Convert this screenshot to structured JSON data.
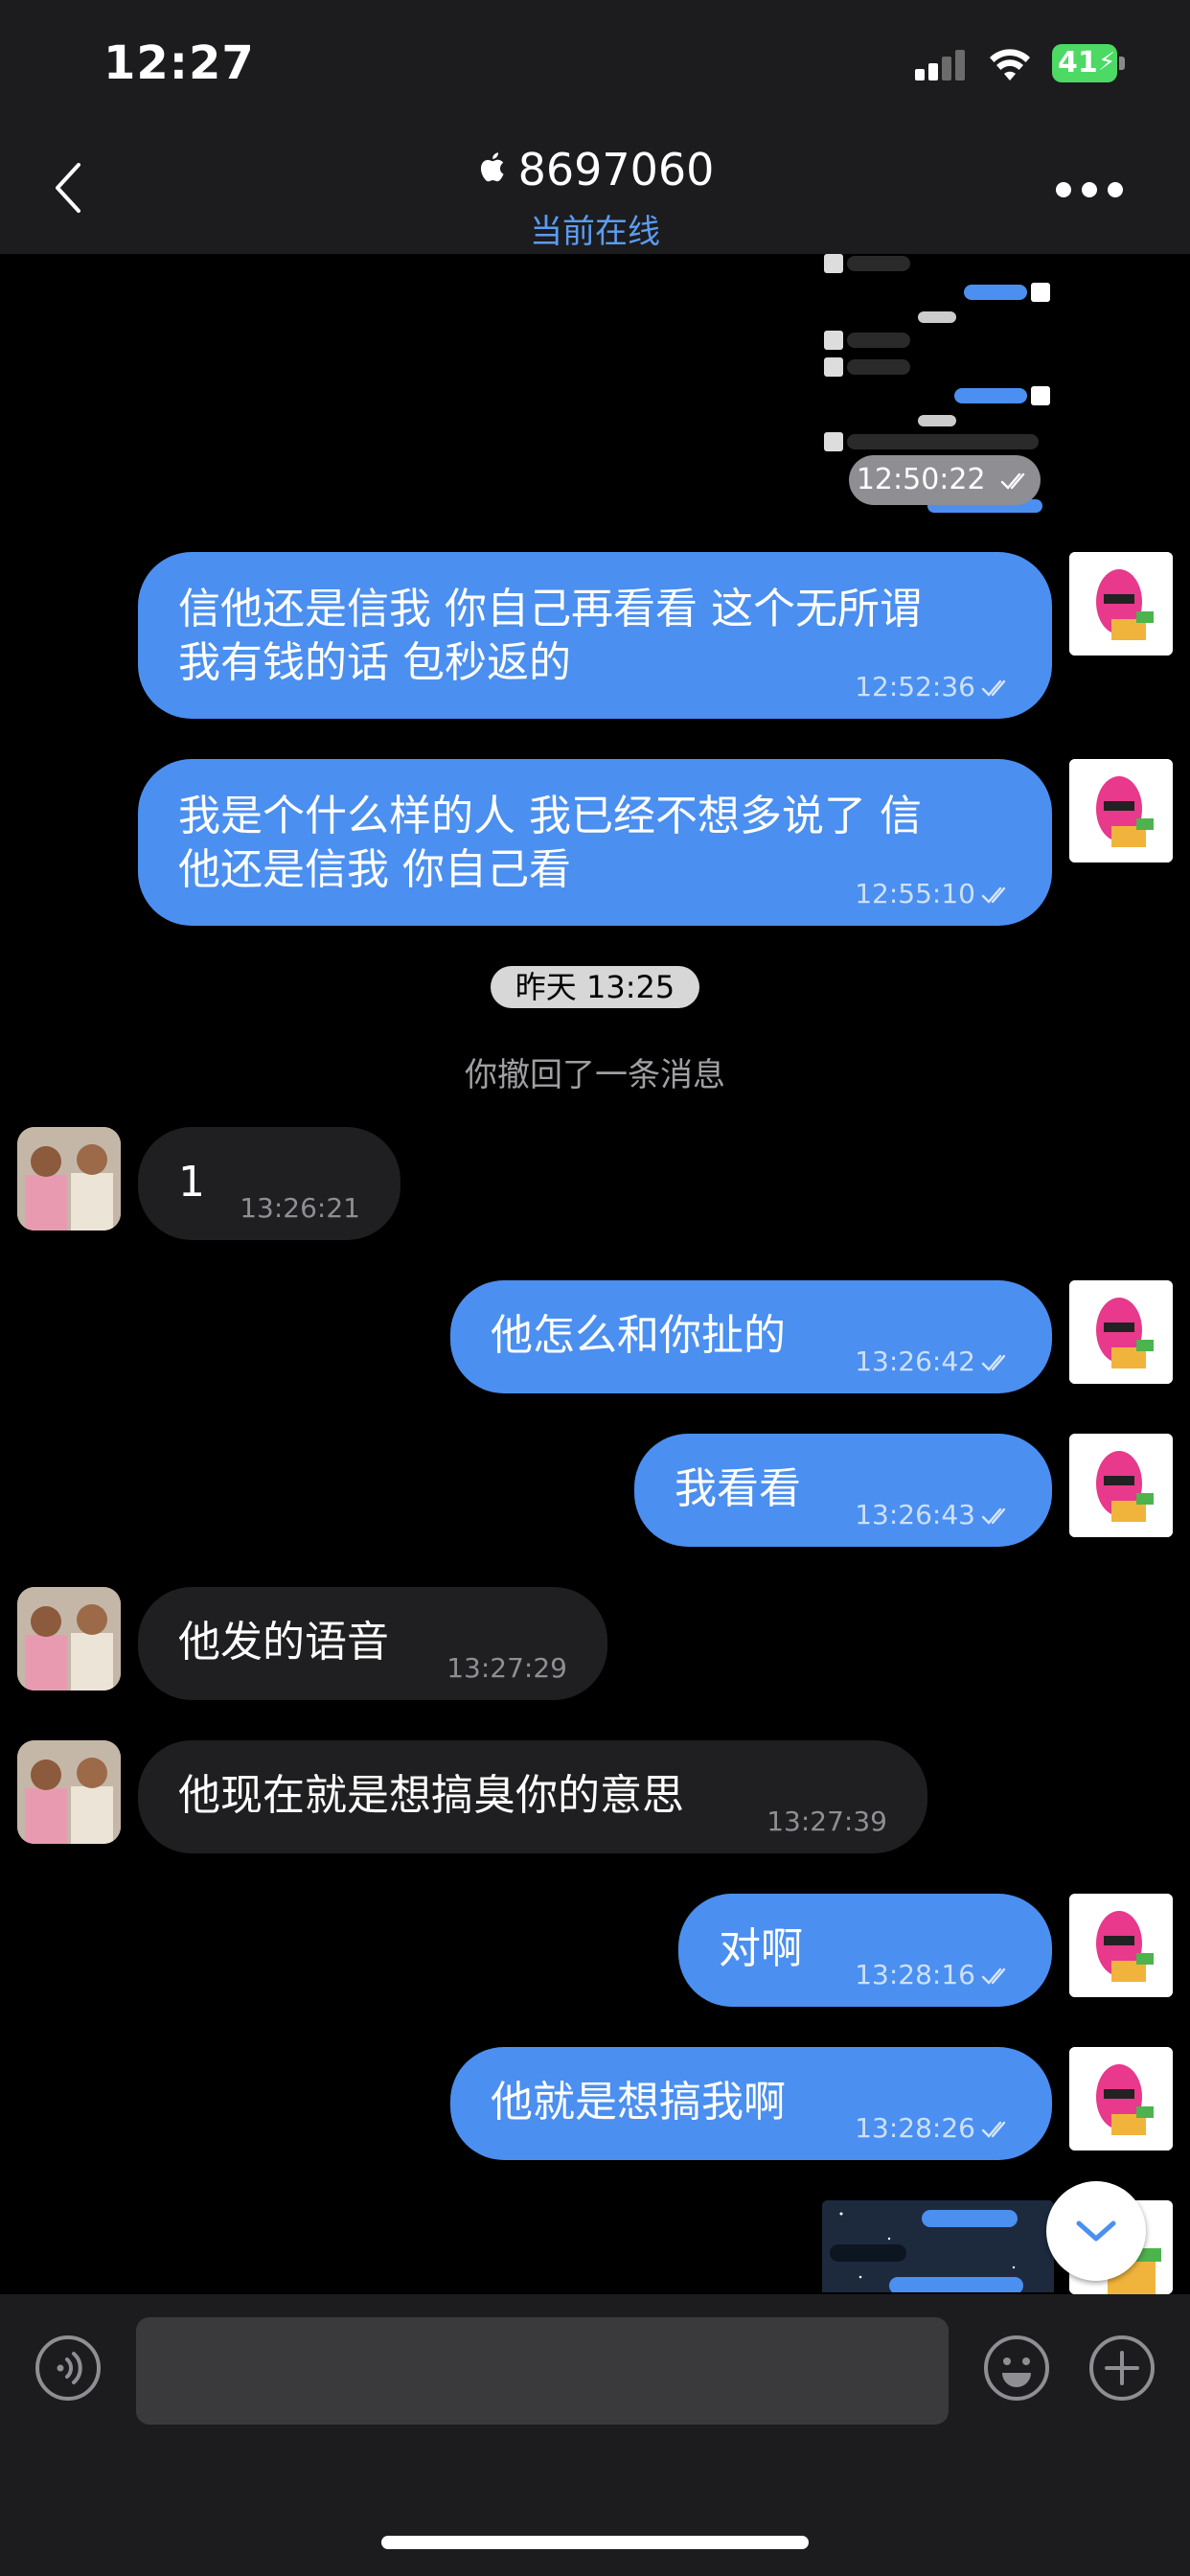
{
  "status_bar": {
    "time": "12:27",
    "battery": "41"
  },
  "header": {
    "contact_id": "8697060",
    "status": "当前在线"
  },
  "thumbnail_top": {
    "timestamp": "12:50:22"
  },
  "messages": [
    {
      "side": "me",
      "text": "信他还是信我 你自己再看看 这个无所谓\n我有钱的话 包秒返的",
      "time": "12:52:36"
    },
    {
      "side": "me",
      "text": "我是个什么样的人 我已经不想多说了 信\n他还是信我 你自己看",
      "time": "12:55:10"
    },
    {
      "side": "them",
      "text": "1",
      "time": "13:26:21"
    },
    {
      "side": "me",
      "text": "他怎么和你扯的",
      "time": "13:26:42"
    },
    {
      "side": "me",
      "text": "我看看",
      "time": "13:26:43"
    },
    {
      "side": "them",
      "text": "他发的语音",
      "time": "13:27:29"
    },
    {
      "side": "them",
      "text": "他现在就是想搞臭你的意思",
      "time": "13:27:39"
    },
    {
      "side": "me",
      "text": "对啊",
      "time": "13:28:16"
    },
    {
      "side": "me",
      "text": "他就是想搞我啊",
      "time": "13:28:26"
    }
  ],
  "date_separator": "昨天 13:25",
  "recall_notice": "你撤回了一条消息",
  "input": {
    "placeholder": ""
  },
  "colors": {
    "accent": "#4b8ff0",
    "header_bg": "#1c1c1e",
    "incoming_bg": "#1f1f21",
    "online": "#5b9cf2"
  },
  "icons": [
    "back-chevron-icon",
    "apple-logo-icon",
    "more-dots-icon",
    "voice-icon",
    "emoji-icon",
    "plus-icon",
    "chevron-down-icon",
    "double-check-icon"
  ]
}
